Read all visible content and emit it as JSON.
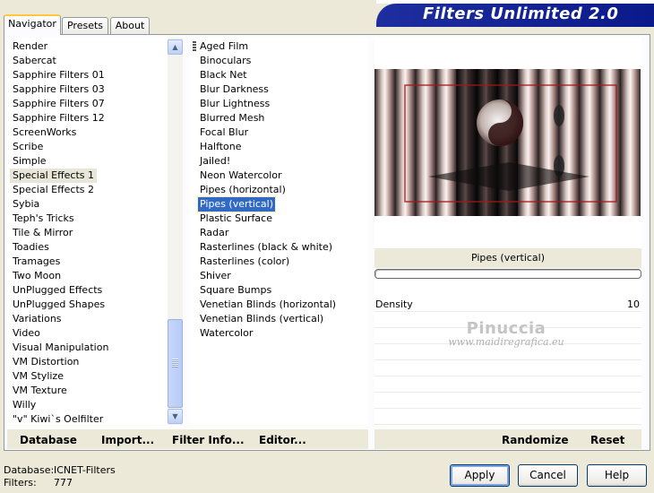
{
  "window": {
    "banner_title": "Filters Unlimited 2.0"
  },
  "tabs": [
    {
      "label": "Navigator",
      "active": true
    },
    {
      "label": "Presets",
      "active": false
    },
    {
      "label": "About",
      "active": false
    }
  ],
  "categories": {
    "items": [
      "Render",
      "Sabercat",
      "Sapphire Filters 01",
      "Sapphire Filters 03",
      "Sapphire Filters 07",
      "Sapphire Filters 12",
      "ScreenWorks",
      "Scribe",
      "Simple",
      "Special Effects 1",
      "Special Effects 2",
      "Sybia",
      "Teph's Tricks",
      "Tile & Mirror",
      "Toadies",
      "Tramages",
      "Two Moon",
      "UnPlugged Effects",
      "UnPlugged Shapes",
      "Variations",
      "Video",
      "Visual Manipulation",
      "VM Distortion",
      "VM Stylize",
      "VM Texture",
      "Willy",
      "\"v\" Kiwi`s Oelfilter"
    ],
    "selected": "Special Effects 1"
  },
  "filters": {
    "items": [
      "Aged Film",
      "Binoculars",
      "Black Net",
      "Blur Darkness",
      "Blur Lightness",
      "Blurred Mesh",
      "Focal Blur",
      "Halftone",
      "Jailed!",
      "Neon Watercolor",
      "Pipes (horizontal)",
      "Pipes (vertical)",
      "Plastic Surface",
      "Radar",
      "Rasterlines (black & white)",
      "Rasterlines (color)",
      "Shiver",
      "Square Bumps",
      "Venetian Blinds (horizontal)",
      "Venetian Blinds (vertical)",
      "Watercolor"
    ],
    "selected": "Pipes (vertical)"
  },
  "preview": {
    "effect_name": "Pipes (vertical)",
    "watermark_main": "Pinuccia",
    "watermark_sub": "www.maidiregrafica.eu"
  },
  "params": [
    {
      "label": "Density",
      "value": "10"
    }
  ],
  "toolbar": {
    "database": "Database",
    "import": "Import...",
    "filter_info": "Filter Info...",
    "editor": "Editor...",
    "randomize": "Randomize",
    "reset": "Reset"
  },
  "status": {
    "database_label": "Database:",
    "database_value": "ICNET-Filters",
    "filters_label": "Filters:",
    "filters_value": "777"
  },
  "buttons": {
    "apply": "Apply",
    "cancel": "Cancel",
    "help": "Help"
  },
  "colors": {
    "accent": "#316ac5",
    "banner": "#0a1a8a",
    "face": "#ece9d8"
  }
}
